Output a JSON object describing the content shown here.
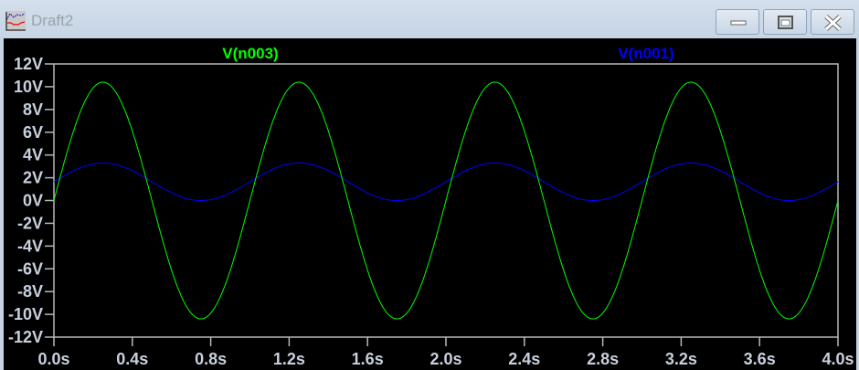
{
  "window": {
    "title": "Draft2",
    "buttons": [
      "minimize",
      "maximize",
      "close"
    ]
  },
  "chart_data": {
    "type": "line",
    "xlabel": "",
    "ylabel": "",
    "xlim": [
      0,
      4.0
    ],
    "ylim": [
      -12,
      12
    ],
    "xticks": [
      "0.0s",
      "0.4s",
      "0.8s",
      "1.2s",
      "1.6s",
      "2.0s",
      "2.4s",
      "2.8s",
      "3.2s",
      "3.6s",
      "4.0s"
    ],
    "yticks": [
      "12V",
      "10V",
      "8V",
      "6V",
      "4V",
      "2V",
      "0V",
      "-2V",
      "-4V",
      "-6V",
      "-8V",
      "-10V",
      "-12V"
    ],
    "series": [
      {
        "name": "V(n003)",
        "color": "#00ff00",
        "function": "sine",
        "amplitude": 10.4,
        "offset": 0,
        "frequency_hz": 1,
        "phase_deg": 0
      },
      {
        "name": "V(n001)",
        "color": "#0000ff",
        "function": "sine",
        "amplitude": 1.65,
        "offset": 1.65,
        "frequency_hz": 1,
        "phase_deg": 0
      }
    ],
    "background": "#000000",
    "grid": false
  }
}
